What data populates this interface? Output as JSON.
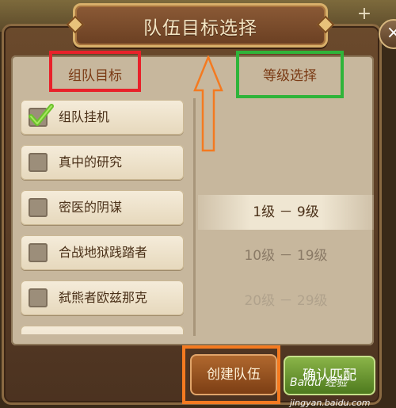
{
  "dialog": {
    "title": "队伍目标选择",
    "close_icon": "×",
    "add_icon": "+"
  },
  "left_header": "组队目标",
  "right_header": "等级选择",
  "targets": [
    {
      "label": "组队挂机",
      "checked": true
    },
    {
      "label": "真中的研究",
      "checked": false
    },
    {
      "label": "密医的阴谋",
      "checked": false
    },
    {
      "label": "合战地狱践踏者",
      "checked": false
    },
    {
      "label": "弑熊者欧兹那克",
      "checked": false
    }
  ],
  "levels": [
    {
      "label": "1级 － 9级",
      "selected": true
    },
    {
      "label": "10级 － 19级",
      "selected": false
    },
    {
      "label": "20级 － 29级",
      "selected": false
    }
  ],
  "buttons": {
    "create": "创建队伍",
    "confirm": "确认匹配"
  },
  "watermark": {
    "brand": "Baidu 经验",
    "domain": "jingyan.baidu.com"
  },
  "colors": {
    "annotation_red": "#e8212a",
    "annotation_green": "#2fb43a",
    "annotation_orange": "#f47a20",
    "checkmark_green": "#6cc22c"
  }
}
